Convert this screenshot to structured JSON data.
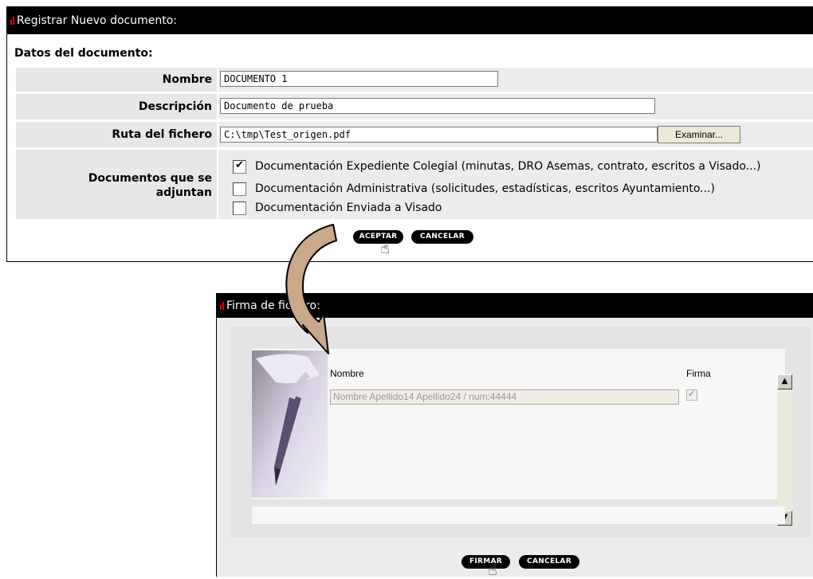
{
  "register": {
    "title": "Registrar Nuevo documento:",
    "section_title": "Datos del documento:",
    "nombre_label": "Nombre",
    "nombre_value": "DOCUMENTO 1",
    "descripcion_label": "Descripción",
    "descripcion_value": "Documento de prueba",
    "ruta_label": "Ruta del fichero",
    "ruta_value": "C:\\tmp\\Test_origen.pdf",
    "examinar_label": "Examinar...",
    "adjuntos_label_line1": "Documentos que se",
    "adjuntos_label_line2": "adjuntan",
    "options": [
      {
        "label": "Documentación Expediente Colegial (minutas, DRO Asemas, contrato, escritos a Visado...)",
        "checked": true
      },
      {
        "label": "Documentación Administrativa (solicitudes, estadísticas, escritos Ayuntamiento...)",
        "checked": false
      },
      {
        "label": "Documentación Enviada a Visado",
        "checked": false
      }
    ],
    "aceptar_label": "ACEPTAR",
    "cancelar_label": "CANCELAR"
  },
  "firma": {
    "title": "Firma de fichero:",
    "nombre_header": "Nombre",
    "firma_header": "Firma",
    "nombre_value": "Nombre Apellido14 Apellido24 / num:44444",
    "firma_checked": true,
    "firmar_label": "FIRMAR",
    "cancelar_label": "CANCELAR"
  },
  "colors": {
    "titlebar": "#000000",
    "accent_red": "#e00000",
    "arrow_fill": "#c9a98a"
  },
  "icons": [
    "hand-cursor-icon",
    "curved-arrow-icon",
    "pen-icon",
    "scroll-up-icon",
    "scroll-down-icon"
  ]
}
